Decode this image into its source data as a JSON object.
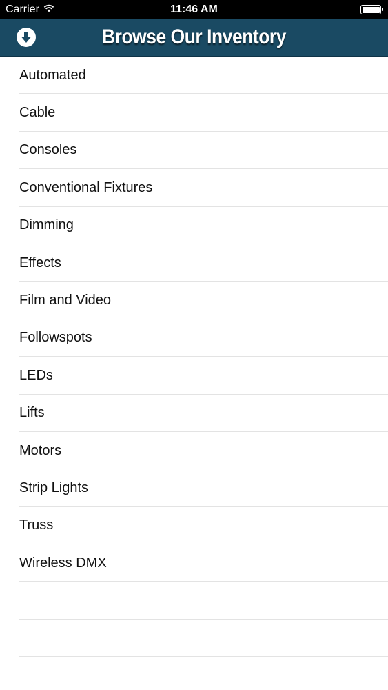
{
  "status_bar": {
    "carrier": "Carrier",
    "time": "11:46 AM",
    "wifi_icon": "wifi-icon",
    "battery_icon": "battery-icon"
  },
  "nav_bar": {
    "title": "Browse Our Inventory",
    "left_icon": "download-arrow-icon",
    "background_color": "#1a4a63"
  },
  "categories": [
    "Automated",
    "Cable",
    "Consoles",
    "Conventional Fixtures",
    "Dimming",
    "Effects",
    "Film and Video",
    "Followspots",
    "LEDs",
    "Lifts",
    "Motors",
    "Strip Lights",
    "Truss",
    "Wireless DMX"
  ]
}
